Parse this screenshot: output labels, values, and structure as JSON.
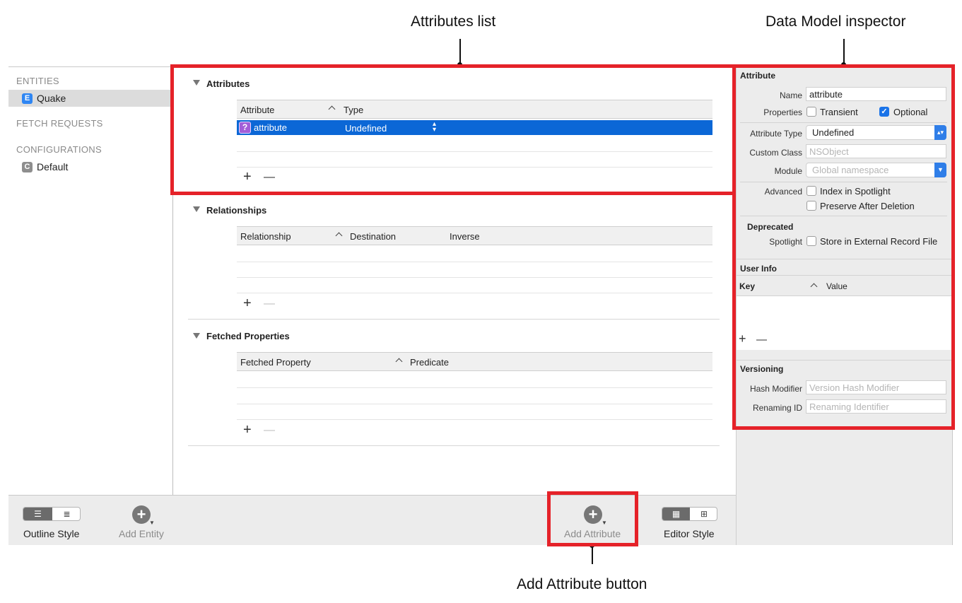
{
  "callouts": {
    "attributes_list": "Attributes list",
    "inspector": "Data Model inspector",
    "add_attribute_button": "Add Attribute button"
  },
  "sidebar": {
    "entities_header": "ENTITIES",
    "entity": {
      "badge": "E",
      "label": "Quake",
      "badge_color": "#2f86f3"
    },
    "fetch_requests_header": "FETCH REQUESTS",
    "configurations_header": "CONFIGURATIONS",
    "configuration": {
      "badge": "C",
      "label": "Default",
      "badge_color": "#8e8e8e"
    }
  },
  "editor": {
    "attributes": {
      "title": "Attributes",
      "columns": [
        "Attribute",
        "Type"
      ],
      "rows": [
        {
          "badge": "?",
          "name": "attribute",
          "type": "Undefined"
        }
      ]
    },
    "relationships": {
      "title": "Relationships",
      "columns": [
        "Relationship",
        "Destination",
        "Inverse"
      ]
    },
    "fetched_properties": {
      "title": "Fetched Properties",
      "columns": [
        "Fetched Property",
        "Predicate"
      ]
    },
    "add_glyph": "+",
    "remove_glyph": "—"
  },
  "bottombar": {
    "outline_style": "Outline Style",
    "add_entity": "Add Entity",
    "add_attribute": "Add Attribute",
    "editor_style": "Editor Style"
  },
  "inspector": {
    "section_attribute": "Attribute",
    "name_label": "Name",
    "name_value": "attribute",
    "properties_label": "Properties",
    "transient": {
      "label": "Transient",
      "checked": false
    },
    "optional": {
      "label": "Optional",
      "checked": true
    },
    "attribute_type_label": "Attribute Type",
    "attribute_type_value": "Undefined",
    "custom_class_label": "Custom Class",
    "custom_class_placeholder": "NSObject",
    "module_label": "Module",
    "module_placeholder": "Global namespace",
    "advanced_label": "Advanced",
    "index_spotlight": "Index in Spotlight",
    "preserve_after_deletion": "Preserve After Deletion",
    "deprecated_label": "Deprecated",
    "spotlight_label": "Spotlight",
    "store_external": "Store in External Record File",
    "user_info_title": "User Info",
    "user_info_columns": [
      "Key",
      "Value"
    ],
    "versioning_title": "Versioning",
    "hash_modifier_label": "Hash Modifier",
    "hash_modifier_placeholder": "Version Hash Modifier",
    "renaming_id_label": "Renaming ID",
    "renaming_id_placeholder": "Renaming Identifier"
  },
  "colors": {
    "highlight": "#e52229",
    "selection": "#0b67d6"
  }
}
